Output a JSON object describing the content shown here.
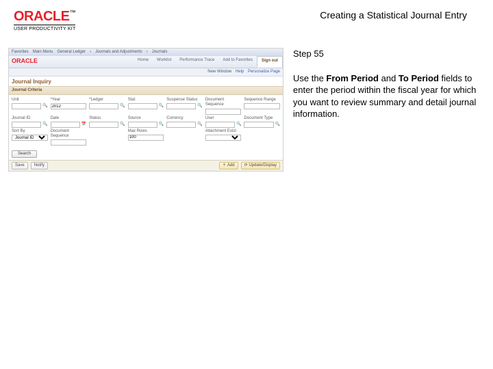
{
  "header": {
    "brand": "ORACLE",
    "brand_suffix": "™",
    "product_line": "USER PRODUCTIVITY KIT",
    "doc_title": "Creating a Statistical Journal Entry"
  },
  "instruction": {
    "step_label": "Step 55",
    "pre": "Use the ",
    "b1": "From Period",
    "mid": " and ",
    "b2": "To Period",
    "post": " fields to enter the period within the fiscal year for which you want to review summary and detail journal information."
  },
  "screenshot": {
    "crumb1": "Favorites",
    "crumb2": "Main Menu",
    "crumb3": "General Ledger",
    "crumb4": "Journals and Adjustments",
    "crumb5": "Journals",
    "brand": "ORACLE",
    "tabs": [
      "Home",
      "Worklist",
      "Performance Trace",
      "Add to Favorites",
      "Sign out"
    ],
    "user_line": "New Window",
    "user_links": [
      "Help",
      "Personalize Page"
    ],
    "page_title": "Journal Inquiry",
    "section": "Journal Criteria",
    "fields": {
      "r1": [
        {
          "label": "Unit",
          "value": ""
        },
        {
          "label": "*Year",
          "value": "2012"
        },
        {
          "label": "*Ledger",
          "value": ""
        },
        {
          "label": "Stat",
          "value": ""
        },
        {
          "label": "Suspense Status",
          "value": ""
        },
        {
          "label": "Document Sequence",
          "value": ""
        },
        {
          "label": "Sequence Range",
          "value": ""
        }
      ],
      "r2": [
        {
          "label": "Journal ID",
          "value": ""
        },
        {
          "label": "Date",
          "value": ""
        },
        {
          "label": "Status",
          "value": ""
        },
        {
          "label": "Source",
          "value": ""
        },
        {
          "label": "Currency",
          "value": ""
        },
        {
          "label": "User",
          "value": ""
        },
        {
          "label": "Document Type",
          "value": ""
        }
      ],
      "r3": [
        {
          "label": "Sort By",
          "value": "Journal ID"
        },
        {
          "label": "Document Sequence",
          "value": ""
        },
        {
          "label": "",
          "value": ""
        },
        {
          "label": "Max Rows",
          "value": "100"
        },
        {
          "label": "",
          "value": ""
        },
        {
          "label": "Attachment Exist",
          "value": ""
        },
        {
          "label": "",
          "value": ""
        }
      ]
    },
    "search_btn": "Search",
    "bottom": {
      "save": "Save",
      "notify": "Notify",
      "add": "Add",
      "update": "Update/Display"
    }
  }
}
